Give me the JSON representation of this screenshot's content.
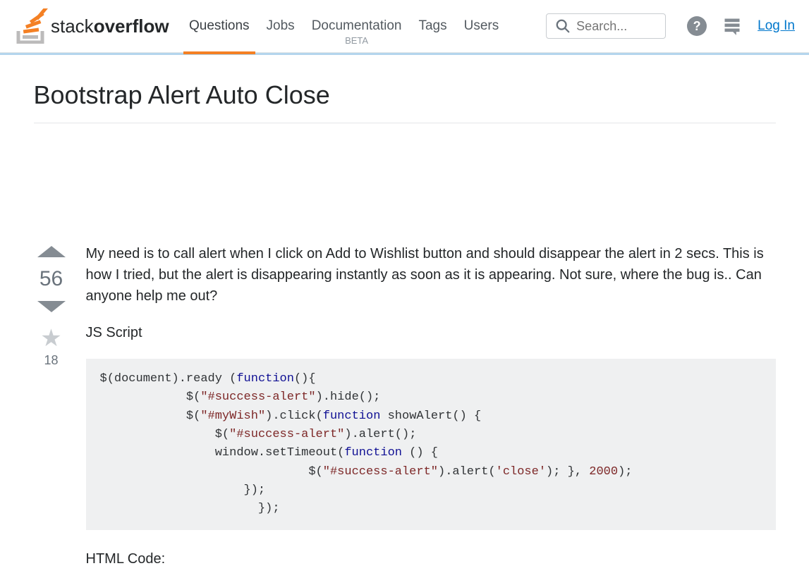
{
  "logo": {
    "name1": "stack",
    "name2": "overflow"
  },
  "nav": {
    "questions": "Questions",
    "jobs": "Jobs",
    "documentation": "Documentation",
    "doc_sub": "BETA",
    "tags": "Tags",
    "users": "Users"
  },
  "search": {
    "placeholder": "Search..."
  },
  "topbar": {
    "login": "Log In"
  },
  "question": {
    "title": "Bootstrap Alert Auto Close",
    "body": "My need is to call alert when I click on Add to Wishlist button and should disappear the alert in 2 secs. This is how I tried, but the alert is disappearing instantly as soon as it is appearing. Not sure, where the bug is.. Can anyone help me out?",
    "js_label": "JS Script",
    "html_label": "HTML Code:",
    "votes": "56",
    "favorites": "18"
  }
}
